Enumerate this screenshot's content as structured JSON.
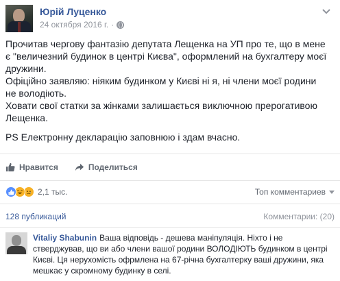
{
  "post": {
    "author": "Юрій Луценко",
    "date": "24 октября 2016 г.",
    "separator": "·",
    "paragraphs": [
      "Прочитав чергову фантазію депутата Лещенка на УП про те, що в мене є \"величезний будинок в центрі Києва\", оформлений на бухгалтеру моєї дружини.",
      "Офіційно заявляю: ніяким будинком у Києві ні я, ні члени моєї родини не володіють.",
      "Ховати свої статки за жінками залишається виключною прерогативою Лещенка.",
      "PS Електронну декларацію заповнюю і здам вчасно."
    ]
  },
  "actions": {
    "like_label": "Нравится",
    "share_label": "Поделиться"
  },
  "reactions": {
    "count": "2,1 тыс.",
    "sort_label": "Топ комментариев",
    "icons": [
      "like-icon",
      "haha-icon",
      "sad-icon"
    ]
  },
  "comments_meta": {
    "publications": "128 публикаций",
    "comments_label": "Комментарии: (20)"
  },
  "comment": {
    "name": "Vitaliy Shabunin",
    "text": "Ваша відповідь - дешева маніпуляція. Ніхто і не стверджував, що ви або члени вашої родини ВОЛОДІЮТЬ будинком в центрі Києві. Ця нерухомість офрмлена на 67-річна бухгалтерку ваші дружини, яка мешкає у скромному будинку в селі."
  },
  "colors": {
    "link": "#365899",
    "text": "#1d2129",
    "muted": "#90949c",
    "like_blue": "#5890ff",
    "emoji_yellow": "#f7b125"
  }
}
